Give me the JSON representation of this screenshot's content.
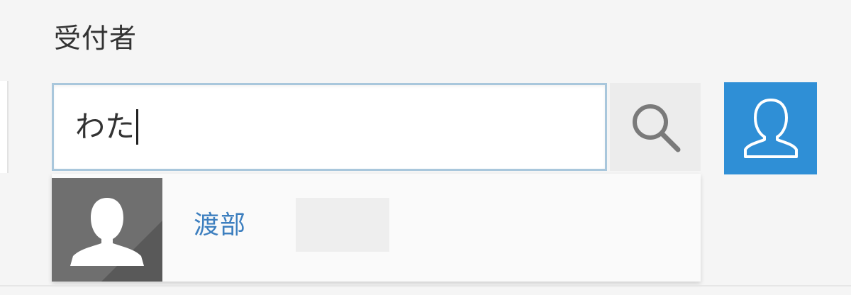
{
  "field": {
    "label": "受付者",
    "input_value": "わた"
  },
  "search_button": {
    "icon": "search-icon"
  },
  "user_select_button": {
    "icon": "user-icon",
    "color": "#2f8fd6"
  },
  "suggestions": [
    {
      "name": "渡部",
      "avatar_icon": "user-avatar-icon"
    }
  ],
  "colors": {
    "accent": "#2f8fd6",
    "link": "#3d7fbf",
    "input_border": "#a9c7dc"
  }
}
